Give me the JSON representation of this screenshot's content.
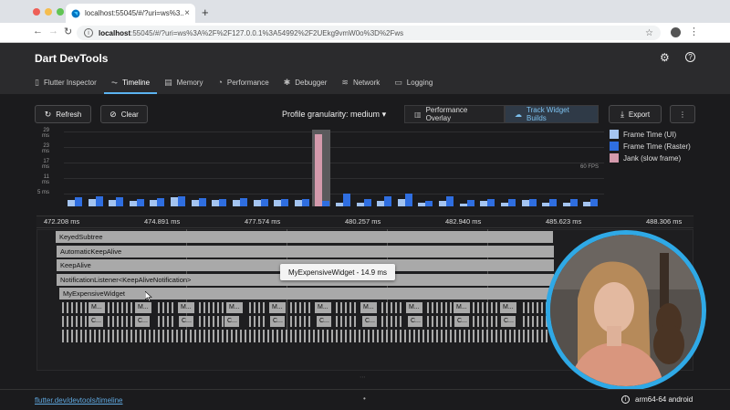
{
  "browser": {
    "tab_title": "localhost:55045/#/?uri=ws%3...",
    "tab_close": "×",
    "new_tab": "+",
    "url_host": "localhost",
    "url_rest": ":55045/#/?uri=ws%3A%2F%2F127.0.0.1%3A54992%2F2UEkg9vmW0o%3D%2Fws",
    "nav_back": "←",
    "nav_forward": "→",
    "nav_reload": "↻",
    "star": "☆",
    "menu": "⋮",
    "info": "i"
  },
  "app": {
    "title": "Dart DevTools",
    "settings_icon": "⚙",
    "help_icon": "?",
    "tabs": [
      {
        "label": "Flutter Inspector",
        "icon": "▯"
      },
      {
        "label": "Timeline",
        "icon": "⏦"
      },
      {
        "label": "Memory",
        "icon": "▤"
      },
      {
        "label": "Performance",
        "icon": "◔"
      },
      {
        "label": "Debugger",
        "icon": "✱"
      },
      {
        "label": "Network",
        "icon": "≋"
      },
      {
        "label": "Logging",
        "icon": "▭"
      }
    ]
  },
  "toolbar": {
    "refresh_label": "Refresh",
    "refresh_icon": "↻",
    "clear_label": "Clear",
    "clear_icon": "⊘",
    "granularity_label": "Profile granularity: medium",
    "granularity_caret": "▾",
    "performance_overlay_label": "Performance Overlay",
    "performance_overlay_icon": "▥",
    "track_widget_builds_label": "Track Widget Builds",
    "track_widget_builds_icon": "☁",
    "export_label": "Export",
    "export_icon": "⤓",
    "more_icon": "⋮"
  },
  "chart_data": {
    "type": "bar",
    "y_tick_labels": [
      "29 ms",
      "23 ms",
      "17 ms",
      "11 ms",
      "5 ms"
    ],
    "ylim": [
      0,
      29
    ],
    "target_label": "60 FPS",
    "legend": [
      {
        "name": "Frame Time (UI)",
        "color": "#a4c4f0"
      },
      {
        "name": "Frame Time (Raster)",
        "color": "#2f6ee0"
      },
      {
        "name": "Jank (slow frame)",
        "color": "#d49aac"
      }
    ],
    "frames": [
      {
        "ui": 2.5,
        "raster": 3.5
      },
      {
        "ui": 3.0,
        "raster": 3.8
      },
      {
        "ui": 2.3,
        "raster": 3.6
      },
      {
        "ui": 2.0,
        "raster": 3.0
      },
      {
        "ui": 2.5,
        "raster": 3.3
      },
      {
        "ui": 3.5,
        "raster": 3.8
      },
      {
        "ui": 2.5,
        "raster": 3.2
      },
      {
        "ui": 2.6,
        "raster": 3.0
      },
      {
        "ui": 2.3,
        "raster": 3.2
      },
      {
        "ui": 2.5,
        "raster": 3.0
      },
      {
        "ui": 2.3,
        "raster": 3.0
      },
      {
        "ui": 2.3,
        "raster": 3.0
      },
      {
        "ui": 28.0,
        "raster": 2.0,
        "jank": true
      },
      {
        "ui": 1.5,
        "raster": 5.0
      },
      {
        "ui": 1.5,
        "raster": 3.0
      },
      {
        "ui": 2.0,
        "raster": 4.0
      },
      {
        "ui": 3.0,
        "raster": 5.0
      },
      {
        "ui": 1.5,
        "raster": 2.0
      },
      {
        "ui": 2.0,
        "raster": 4.0
      },
      {
        "ui": 1.0,
        "raster": 2.5
      },
      {
        "ui": 2.0,
        "raster": 3.0
      },
      {
        "ui": 1.5,
        "raster": 3.0
      },
      {
        "ui": 2.5,
        "raster": 3.0
      },
      {
        "ui": 1.5,
        "raster": 3.0
      },
      {
        "ui": 1.5,
        "raster": 3.0
      },
      {
        "ui": 1.8,
        "raster": 3.0
      }
    ]
  },
  "timeline": {
    "ticks": [
      "472.208 ms",
      "474.891 ms",
      "477.574 ms",
      "480.257 ms",
      "482.940 ms",
      "485.623 ms",
      "488.306 ms"
    ],
    "rows": [
      "KeyedSubtree",
      "AutomaticKeepAlive",
      "KeepAlive",
      "NotificationListener<KeepAliveNotification>",
      "MyExpensiveWidget"
    ],
    "mini_label_m": "M...",
    "mini_label_c": "C...",
    "tooltip": "MyExpensiveWidget - 14.9 ms",
    "resize_handle": "⋯"
  },
  "status": {
    "link": "flutter.dev/devtools/timeline",
    "dot": "•",
    "info_icon": "i",
    "device": "arm64-64 android"
  }
}
